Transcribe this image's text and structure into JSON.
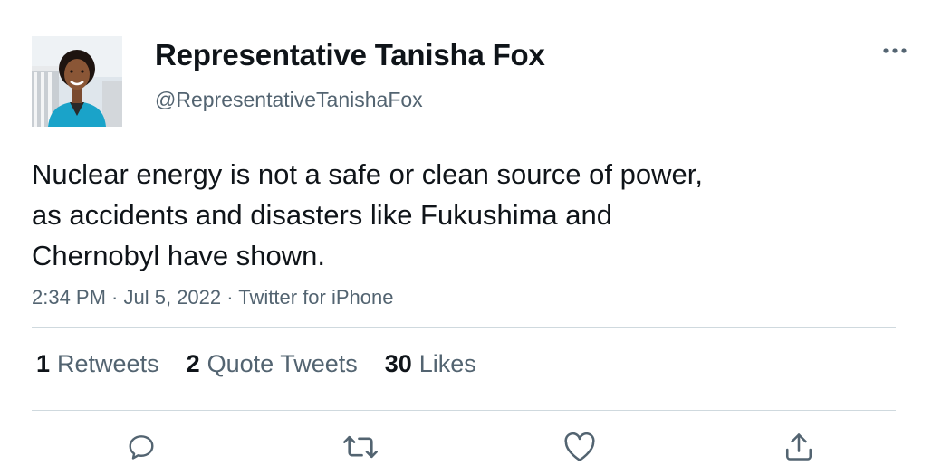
{
  "author": {
    "name": "Representative Tanisha Fox",
    "handle": "@RepresentativeTanishaFox",
    "avatar_icon": "profile-photo"
  },
  "tweet": {
    "lines": [
      "Nuclear energy is not a safe or clean source of power,",
      "as accidents and disasters like Fukushima and",
      "Chernobyl have shown."
    ],
    "time": "2:34 PM",
    "date": "Jul 5, 2022",
    "source": "Twitter for iPhone",
    "separator": " · "
  },
  "stats": {
    "retweets": {
      "count": "1",
      "label": "Retweets"
    },
    "quote_tweets": {
      "count": "2",
      "label": "Quote Tweets"
    },
    "likes": {
      "count": "30",
      "label": "Likes"
    }
  },
  "actions": [
    "reply-icon",
    "retweet-icon",
    "like-icon",
    "share-icon"
  ],
  "menu_icon": "more-icon",
  "colors": {
    "text": "#0f1419",
    "secondary": "#536471",
    "divider": "#cfd9de",
    "jacket": "#1aa3c9"
  }
}
